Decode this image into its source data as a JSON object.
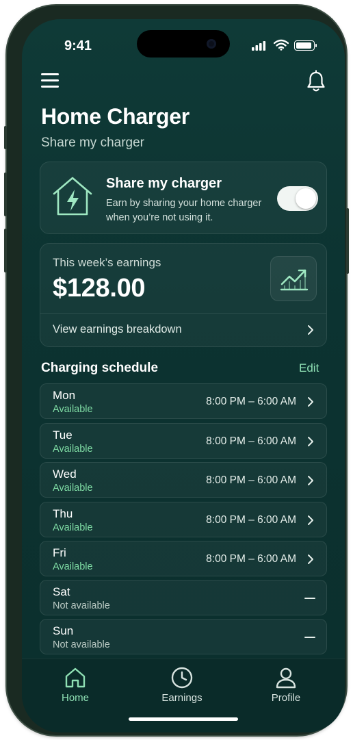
{
  "status_bar": {
    "time": "9:41"
  },
  "header": {
    "title": "Home Charger",
    "subtitle": "Share my charger"
  },
  "share_card": {
    "title": "Share my charger",
    "description": "Earn by sharing your home charger when you’re not using it.",
    "toggle_on": true
  },
  "earnings_card": {
    "label": "This week’s earnings",
    "amount": "$128.00",
    "breakdown_label": "View earnings breakdown"
  },
  "schedule": {
    "title": "Charging schedule",
    "edit_label": "Edit",
    "days": [
      {
        "name": "Mon",
        "status": "Available",
        "time": "8:00 PM – 6:00 AM"
      },
      {
        "name": "Tue",
        "status": "Available",
        "time": "8:00 PM – 6:00 AM"
      },
      {
        "name": "Wed",
        "status": "Available",
        "time": "8:00 PM – 6:00 AM"
      },
      {
        "name": "Thu",
        "status": "Available",
        "time": "8:00 PM – 6:00 AM"
      },
      {
        "name": "Fri",
        "status": "Available",
        "time": "8:00 PM – 6:00 AM"
      },
      {
        "name": "Sat",
        "status": "Not available"
      },
      {
        "name": "Sun",
        "status": "Not available"
      }
    ]
  },
  "tab_bar": {
    "tabs": [
      {
        "label": "Home",
        "icon": "home-icon",
        "active": true
      },
      {
        "label": "Earnings",
        "icon": "clock-icon",
        "active": false
      },
      {
        "label": "Profile",
        "icon": "person-icon",
        "active": false
      }
    ]
  },
  "colors": {
    "background": "#0c3331",
    "accent": "#8fe0b4",
    "available": "#7fdca4",
    "text": "#ffffff"
  }
}
